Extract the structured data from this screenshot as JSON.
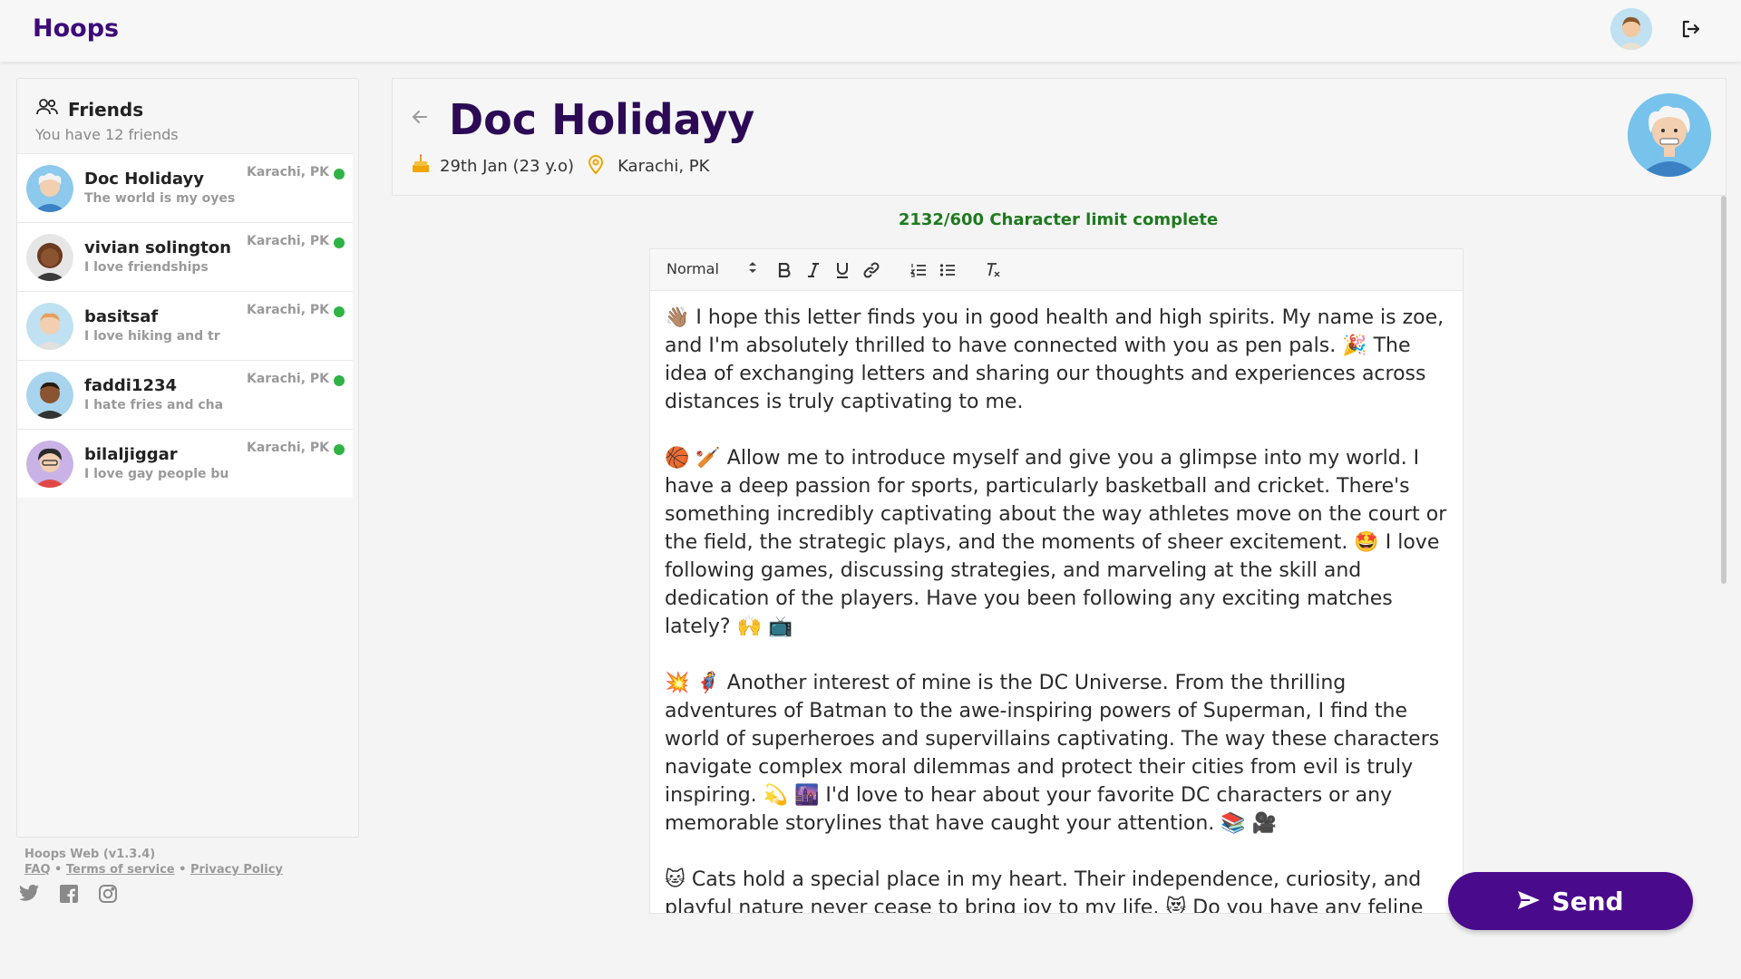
{
  "app": {
    "brand": "Hoops"
  },
  "sidebar": {
    "title": "Friends",
    "subtitle": "You have 12 friends",
    "friends": [
      {
        "name": "Doc Holidayy",
        "bio": "The world is my oyes",
        "location": "Karachi, PK",
        "status": "online"
      },
      {
        "name": "vivian solington",
        "bio": "I love friendships",
        "location": "Karachi, PK",
        "status": "online"
      },
      {
        "name": "basitsaf",
        "bio": "I love hiking and tr",
        "location": "Karachi, PK",
        "status": "online"
      },
      {
        "name": "faddi1234",
        "bio": "I hate fries and cha",
        "location": "Karachi, PK",
        "status": "online"
      },
      {
        "name": "bilaljiggar",
        "bio": "I love gay people bu",
        "location": "Karachi, PK",
        "status": "online"
      }
    ]
  },
  "footer": {
    "version": "Hoops Web (v1.3.4)",
    "faq": "FAQ",
    "terms": "Terms of service",
    "privacy": "Privacy Policy",
    "sep": "•"
  },
  "profile": {
    "name": "Doc Holidayy",
    "birthday": "29th Jan (23 y.o)",
    "location": "Karachi, PK"
  },
  "editor": {
    "char_limit": "2132/600 Character limit complete",
    "format_select": "Normal",
    "paragraphs": [
      "👋🏽 I hope this letter finds you in good health and high spirits. My name is zoe, and I'm absolutely thrilled to have connected with you as pen pals. 🎉 The idea of exchanging letters and sharing our thoughts and experiences across distances is truly captivating to me.",
      "🏀 🏏 Allow me to introduce myself and give you a glimpse into my world. I have a deep passion for sports, particularly basketball and cricket. There's something incredibly captivating about the way athletes move on the court or the field, the strategic plays, and the moments of sheer excitement. 🤩 I love following games, discussing strategies, and marveling at the skill and dedication of the players. Have you been following any exciting matches lately? 🙌 📺",
      "💥 🦸 Another interest of mine is the DC Universe. From the thrilling adventures of Batman to the awe-inspiring powers of Superman, I find the world of superheroes and supervillains captivating. The way these characters navigate complex moral dilemmas and protect their cities from evil is truly inspiring. 💫 🌆 I'd love to hear about your favorite DC characters or any memorable storylines that have caught your attention. 📚 🎥",
      "🐱 Cats hold a special place in my heart. Their independence, curiosity, and playful nature never cease to bring joy to my life. 😻 Do you have any feline"
    ]
  },
  "actions": {
    "send": "Send"
  },
  "colors": {
    "brand": "#3d0a7a",
    "send": "#4a0a8c",
    "online": "#2fb344",
    "success": "#1e7a1e",
    "birthday_icon": "#f0a500",
    "location_icon": "#f0a500"
  }
}
